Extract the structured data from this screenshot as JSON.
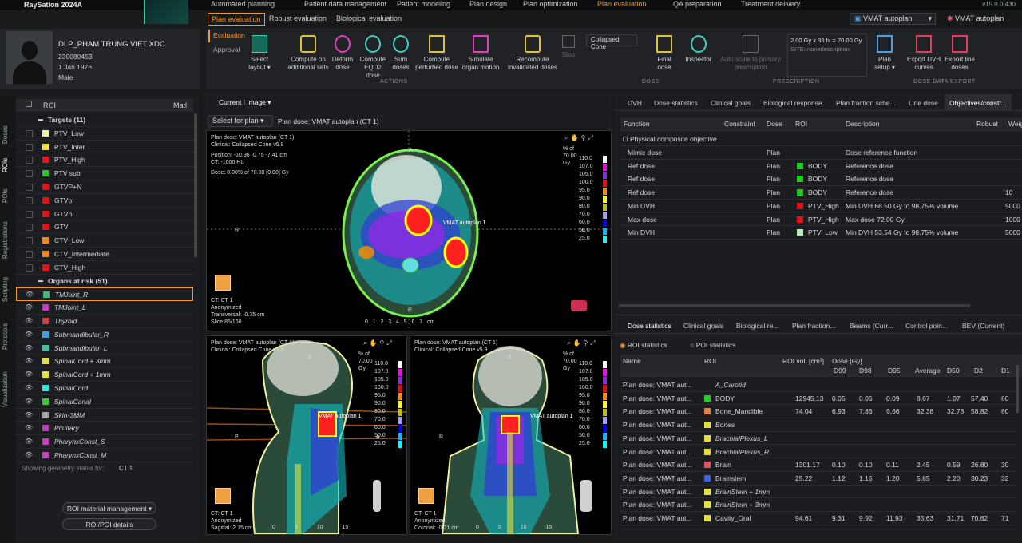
{
  "app": {
    "title": "RaySation 2024A",
    "version": "v15.0.0.430"
  },
  "topnav": [
    "Automated planning",
    "Patient data management",
    "Patient modeling",
    "Plan design",
    "Plan optimization",
    "Plan evaluation",
    "QA preparation",
    "Treatment delivery"
  ],
  "subtabs": [
    "Plan evaluation",
    "Robust evaluation",
    "Biological evaluation"
  ],
  "plan_select": {
    "icon_label": "VMAT autoplan",
    "label": "VMAT autoplan"
  },
  "patient": {
    "name": "DLP_PHAM TRUNG VIET XDC",
    "id": "230080453",
    "dob": "1 Jan 1976",
    "sex": "Male"
  },
  "modes": [
    "Evaluation",
    "Approval"
  ],
  "ribbon": {
    "actions": [
      "Select layout",
      "Compute on additional sets",
      "Deform dose",
      "Compute EQD2 dose",
      "Sum doses",
      "Compute perturbed dose",
      "Simulate organ motion",
      "Recompute invalidated doses",
      "Stop"
    ],
    "actions_group": "ACTIONS",
    "algorithm": "Collapsed Cone",
    "dose_btns": [
      "Final dose",
      "Inspector"
    ],
    "dose_group": "DOSE",
    "prescription_btn": "Auto scale to primary prescription",
    "prescription_text": "2.00 Gy x 35 fx = 70.00 Gy",
    "prescription_site": "SITE: nonedescription",
    "prescription_group": "PRESCRIPTION",
    "export": [
      "Plan setup",
      "Export DVH curves",
      "Export line doses"
    ],
    "export_group": "DOSE DATA EXPORT"
  },
  "sidebar_tabs": [
    "Doses",
    "ROIs",
    "POIs",
    "Registrations",
    "Scripting",
    "Protocols",
    "Visualization"
  ],
  "roi_header": {
    "roi": "ROI",
    "matl": "Matl"
  },
  "targets_header": "Targets (11)",
  "targets": [
    {
      "name": "PTV_Low",
      "color": "#e8f0a0"
    },
    {
      "name": "PTV_Inter",
      "color": "#f5e33c"
    },
    {
      "name": "PTV_High",
      "color": "#e0141a"
    },
    {
      "name": "PTV sub",
      "color": "#2fbf2f"
    },
    {
      "name": "GTVP+N",
      "color": "#e0141a"
    },
    {
      "name": "GTVp",
      "color": "#e0141a"
    },
    {
      "name": "GTVn",
      "color": "#e0141a"
    },
    {
      "name": "GTV",
      "color": "#e0141a"
    },
    {
      "name": "CTV_Low",
      "color": "#f08a1a"
    },
    {
      "name": "CTV_Intermediate",
      "color": "#f08a1a"
    },
    {
      "name": "CTV_High",
      "color": "#e0141a"
    }
  ],
  "oar_header": "Organs at risk (51)",
  "oars": [
    {
      "name": "TMJoint_R",
      "color": "#3cb878"
    },
    {
      "name": "TMJoint_L",
      "color": "#c03cc0"
    },
    {
      "name": "Thyroid",
      "color": "#d04040"
    },
    {
      "name": "Submandibular_R",
      "color": "#40a0e0"
    },
    {
      "name": "Submandibular_L",
      "color": "#40c0a0"
    },
    {
      "name": "SpinalCord + 3mm",
      "color": "#e0e040"
    },
    {
      "name": "SpinalCord + 1mm",
      "color": "#e0e040"
    },
    {
      "name": "SpinalCord",
      "color": "#40e0e0"
    },
    {
      "name": "SpinalCanal",
      "color": "#40c040"
    },
    {
      "name": "Skin-3MM",
      "color": "#a0a0a0"
    },
    {
      "name": "Pituitary",
      "color": "#c040c0"
    },
    {
      "name": "PharynxConst_S",
      "color": "#c040c0"
    },
    {
      "name": "PharynxConst_M",
      "color": "#c040c0"
    }
  ],
  "geometry_status": {
    "label": "Showing geometry status for:",
    "value": "CT 1"
  },
  "roi_buttons": {
    "material": "ROI material management",
    "details": "ROI/POI details"
  },
  "view": {
    "mode": "Current | Image",
    "select_plan": "Select for plan",
    "plan_dose": "Plan dose: VMAT autoplan (CT 1)"
  },
  "vp_main": {
    "lines": [
      "Plan dose: VMAT autoplan (CT 1)",
      "Clinical: Collapsed Cone v5.9",
      "Position: -10.96 -0.75 -7.41 cm",
      "CT: -1000 HU",
      "Dose: 0.00% of 70.00 [0.00] Gy"
    ],
    "bottom": [
      "CT: CT 1",
      "Anonymized",
      "Transversal: -0.75 cm",
      "Slice 85/160"
    ],
    "plan_label": "VMAT autoplan 1",
    "scale_ticks": [
      "0",
      "1",
      "2",
      "3",
      "4",
      "5",
      "6",
      "7"
    ],
    "scale_unit": "cm",
    "orient": {
      "r": "R",
      "l": "L",
      "a": "A",
      "p": "P"
    }
  },
  "legend": {
    "title": "% of 70.00 Gy",
    "levels": [
      {
        "v": "110.0",
        "c": "#ffffff"
      },
      {
        "v": "107.0",
        "c": "#ff00ff"
      },
      {
        "v": "105.0",
        "c": "#8a2be2"
      },
      {
        "v": "100.0",
        "c": "#ff0000"
      },
      {
        "v": "95.0",
        "c": "#ff8c00"
      },
      {
        "v": "90.0",
        "c": "#ffff00"
      },
      {
        "v": "80.0",
        "c": "#c0c000"
      },
      {
        "v": "70.0",
        "c": "#a0a0ff"
      },
      {
        "v": "60.0",
        "c": "#0000ff"
      },
      {
        "v": "50.0",
        "c": "#00c0ff"
      },
      {
        "v": "25.0",
        "c": "#00ffff"
      }
    ]
  },
  "vp_sag": {
    "lines": [
      "Plan dose: VMAT autoplan (CT 1)",
      "Clinical: Collapsed Cone v5.9"
    ],
    "bottom": [
      "CT: CT 1",
      "Anonymized",
      "Sagittal: 2.15 cm"
    ],
    "orient": {
      "p": "P",
      "a": "A",
      "s": "S"
    },
    "plan_label": "VMAT autoplan 1",
    "scale_ticks": [
      "0",
      "5",
      "10",
      "15"
    ]
  },
  "vp_cor": {
    "lines": [
      "Plan dose: VMAT autoplan (CT 1)",
      "Clinical: Collapsed Cone v5.9"
    ],
    "bottom": [
      "CT: CT 1",
      "Anonymized",
      "Coronal: -0.21 cm"
    ],
    "orient": {
      "r": "R",
      "s": "S"
    },
    "plan_label": "VMAT autoplan 1",
    "scale_ticks": [
      "0",
      "5",
      "10",
      "15"
    ]
  },
  "top_tabs": [
    "DVH",
    "Dose statistics",
    "Clinical goals",
    "Biological response",
    "Plan fraction sche...",
    "Line dose",
    "Objectives/constr..."
  ],
  "obj_table": {
    "headers": [
      "Function",
      "Constraint",
      "Dose",
      "ROI",
      "Description",
      "Robust",
      "Weig"
    ],
    "group": "Physical composite objective",
    "rows": [
      {
        "fn": "Mimic dose",
        "dose": "Plan",
        "roi": "",
        "roi_color": "",
        "desc": "Dose reference function",
        "w": ""
      },
      {
        "fn": "Ref dose",
        "dose": "Plan",
        "roi": "BODY",
        "roi_color": "#22cc22",
        "desc": "Reference dose",
        "w": ""
      },
      {
        "fn": "Ref dose",
        "dose": "Plan",
        "roi": "BODY",
        "roi_color": "#22cc22",
        "desc": "Reference dose",
        "w": ""
      },
      {
        "fn": "Ref dose",
        "dose": "Plan",
        "roi": "BODY",
        "roi_color": "#22cc22",
        "desc": "Reference dose",
        "w": "10"
      },
      {
        "fn": "Min DVH",
        "dose": "Plan",
        "roi": "PTV_High",
        "roi_color": "#e0141a",
        "desc": "Min DVH 68.50 Gy to 98.75% volume",
        "w": "5000"
      },
      {
        "fn": "Max dose",
        "dose": "Plan",
        "roi": "PTV_High",
        "roi_color": "#e0141a",
        "desc": "Max dose 72.00 Gy",
        "w": "1000"
      },
      {
        "fn": "Min DVH",
        "dose": "Plan",
        "roi": "PTV_Low",
        "roi_color": "#b8f0b8",
        "desc": "Min DVH 53.54 Gy to 98.75% volume",
        "w": "5000"
      }
    ]
  },
  "bottom_tabs": [
    "Dose statistics",
    "Clinical goals",
    "Biological re...",
    "Plan fraction...",
    "Beams (Curr...",
    "Control poin...",
    "BEV (Current)"
  ],
  "stat_modes": [
    "ROI statistics",
    "POI statistics"
  ],
  "stat_table": {
    "headers": [
      "Name",
      "ROI",
      "ROI vol. [cm³]",
      "Dose [Gy]",
      "D99",
      "D98",
      "D95",
      "Average",
      "D50",
      "D2",
      "D1"
    ],
    "rows": [
      {
        "name": "Plan dose: VMAT aut...",
        "roi": "A_Carotid",
        "c": "",
        "vol": "",
        "d99": "",
        "d98": "",
        "d95": "",
        "avg": "",
        "d50": "",
        "d2": "",
        "d1": ""
      },
      {
        "name": "Plan dose: VMAT aut...",
        "roi": "BODY",
        "c": "#22cc22",
        "vol": "12945.13",
        "d99": "0.05",
        "d98": "0.06",
        "d95": "0.09",
        "avg": "8.67",
        "d50": "1.07",
        "d2": "57.40",
        "d1": "60"
      },
      {
        "name": "Plan dose: VMAT aut...",
        "roi": "Bone_Mandible",
        "c": "#e08040",
        "vol": "74.04",
        "d99": "6.93",
        "d98": "7.86",
        "d95": "9.66",
        "avg": "32.38",
        "d50": "32.78",
        "d2": "58.82",
        "d1": "60"
      },
      {
        "name": "Plan dose: VMAT aut...",
        "roi": "Bones",
        "c": "#e0e040",
        "vol": "",
        "d99": "",
        "d98": "",
        "d95": "",
        "avg": "",
        "d50": "",
        "d2": "",
        "d1": ""
      },
      {
        "name": "Plan dose: VMAT aut...",
        "roi": "BrachialPlexus_L",
        "c": "#e0e040",
        "vol": "",
        "d99": "",
        "d98": "",
        "d95": "",
        "avg": "",
        "d50": "",
        "d2": "",
        "d1": ""
      },
      {
        "name": "Plan dose: VMAT aut...",
        "roi": "BrachialPlexus_R",
        "c": "#e0e040",
        "vol": "",
        "d99": "",
        "d98": "",
        "d95": "",
        "avg": "",
        "d50": "",
        "d2": "",
        "d1": ""
      },
      {
        "name": "Plan dose: VMAT aut...",
        "roi": "Brain",
        "c": "#e05060",
        "vol": "1301.17",
        "d99": "0.10",
        "d98": "0.10",
        "d95": "0.11",
        "avg": "2.45",
        "d50": "0.59",
        "d2": "26.80",
        "d1": "30"
      },
      {
        "name": "Plan dose: VMAT aut...",
        "roi": "Brainstem",
        "c": "#4060e0",
        "vol": "25.22",
        "d99": "1.12",
        "d98": "1.16",
        "d95": "1.20",
        "avg": "5.85",
        "d50": "2.20",
        "d2": "30.23",
        "d1": "32"
      },
      {
        "name": "Plan dose: VMAT aut...",
        "roi": "BrainStem + 1mm",
        "c": "#e0e040",
        "vol": "",
        "d99": "",
        "d98": "",
        "d95": "",
        "avg": "",
        "d50": "",
        "d2": "",
        "d1": ""
      },
      {
        "name": "Plan dose: VMAT aut...",
        "roi": "BrainStem + 3mm",
        "c": "#e0e040",
        "vol": "",
        "d99": "",
        "d98": "",
        "d95": "",
        "avg": "",
        "d50": "",
        "d2": "",
        "d1": ""
      },
      {
        "name": "Plan dose: VMAT aut...",
        "roi": "Cavity_Oral",
        "c": "#e0e040",
        "vol": "94.61",
        "d99": "9.31",
        "d98": "9.92",
        "d95": "11.93",
        "avg": "35.63",
        "d50": "31.71",
        "d2": "70.62",
        "d1": "71"
      }
    ]
  }
}
